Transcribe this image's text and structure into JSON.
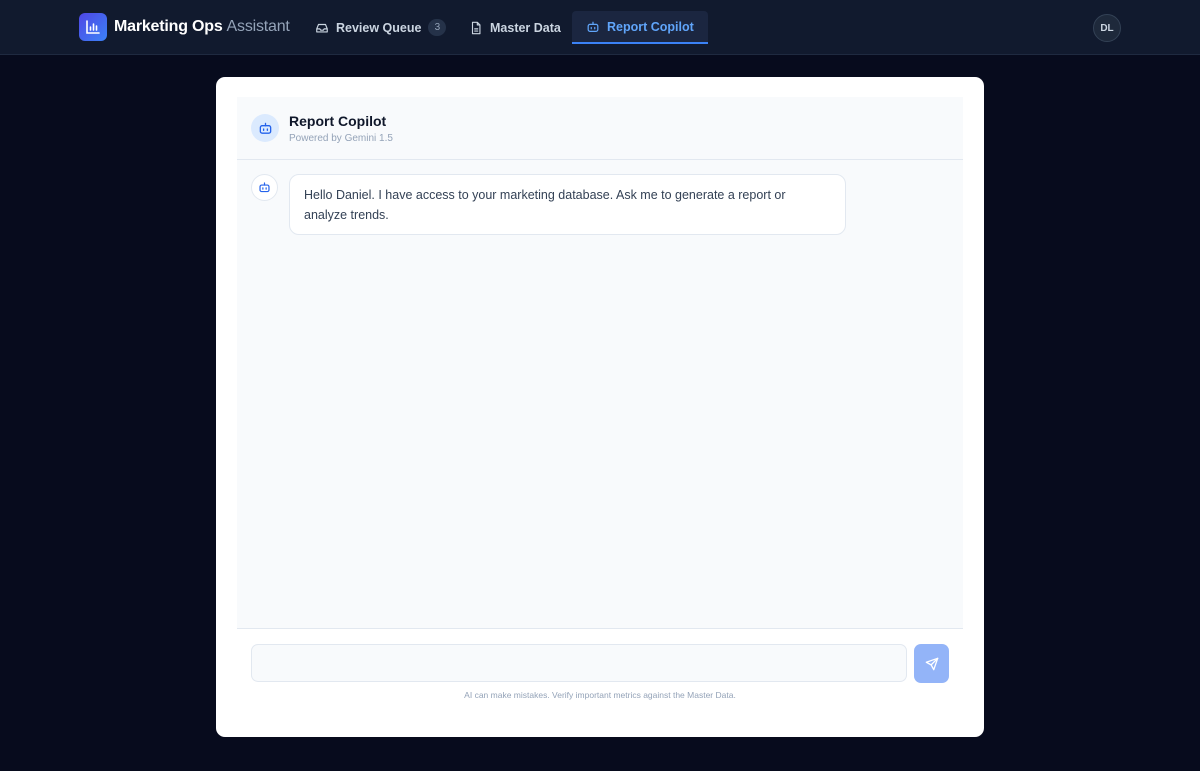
{
  "brand": {
    "name_strong": "Marketing Ops",
    "name_light": "Assistant",
    "icon": "bar-chart-icon"
  },
  "nav": {
    "tabs": [
      {
        "label": "Review Queue",
        "icon": "inbox-icon",
        "badge": "3",
        "active": false
      },
      {
        "label": "Master Data",
        "icon": "file-icon",
        "active": false
      },
      {
        "label": "Report Copilot",
        "icon": "bot-icon",
        "active": true
      }
    ]
  },
  "user": {
    "initials": "DL"
  },
  "chat": {
    "header": {
      "title": "Report Copilot",
      "subtitle": "Powered by Gemini 1.5",
      "icon": "bot-icon"
    },
    "messages": [
      {
        "role": "assistant",
        "icon": "bot-icon",
        "text": "Hello Daniel. I have access to your marketing database. Ask me to generate a report or analyze trends."
      }
    ],
    "input": {
      "value": "",
      "placeholder": ""
    },
    "send_icon": "send-icon",
    "disclaimer": "AI can make mistakes. Verify important metrics against the Master Data."
  },
  "colors": {
    "page_bg": "#070b1d",
    "topbar_bg": "#111a2e",
    "accent": "#3b82f6",
    "active_tab_text": "#60a5fa",
    "send_button": "#93b4f8"
  }
}
